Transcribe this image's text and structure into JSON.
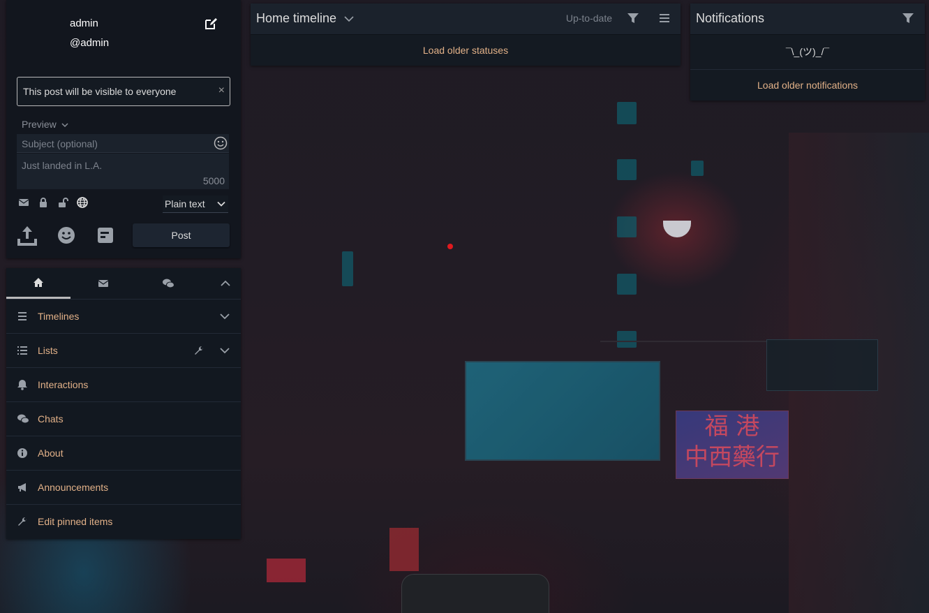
{
  "user": {
    "name": "admin",
    "handle": "@admin"
  },
  "composer": {
    "visibility_notice": "This post will be visible to everyone",
    "close_symbol": "×",
    "preview_label": "Preview",
    "subject_placeholder": "Subject (optional)",
    "status_placeholder": "Just landed in L.A.",
    "char_count": "5000",
    "format_selected": "Plain text",
    "post_label": "Post",
    "scope_icons": [
      "envelope-icon",
      "lock-icon",
      "unlock-icon",
      "globe-icon"
    ],
    "tool_icons": [
      "upload-icon",
      "emoji-icon",
      "poll-icon"
    ]
  },
  "nav": {
    "tabs": [
      "home-icon",
      "envelope-icon",
      "comments-icon"
    ],
    "items": [
      {
        "label": "Timelines",
        "icon": "bars-icon",
        "expandable": true
      },
      {
        "label": "Lists",
        "icon": "list-icon",
        "expandable": true,
        "editable": true
      },
      {
        "label": "Interactions",
        "icon": "bell-icon"
      },
      {
        "label": "Chats",
        "icon": "comments-icon"
      },
      {
        "label": "About",
        "icon": "info-circle-icon"
      },
      {
        "label": "Announcements",
        "icon": "bullhorn-icon"
      },
      {
        "label": "Edit pinned items",
        "icon": "wrench-icon"
      }
    ]
  },
  "timeline": {
    "title": "Home timeline",
    "status": "Up-to-date",
    "load_older": "Load older statuses"
  },
  "notifications": {
    "title": "Notifications",
    "empty": "¯\\_(ツ)_/¯",
    "load_older": "Load older notifications"
  },
  "colors": {
    "panel_bg": "#141a22",
    "header_bg": "#1b222c",
    "link": "#e2b188",
    "text": "#b9b9ba"
  }
}
